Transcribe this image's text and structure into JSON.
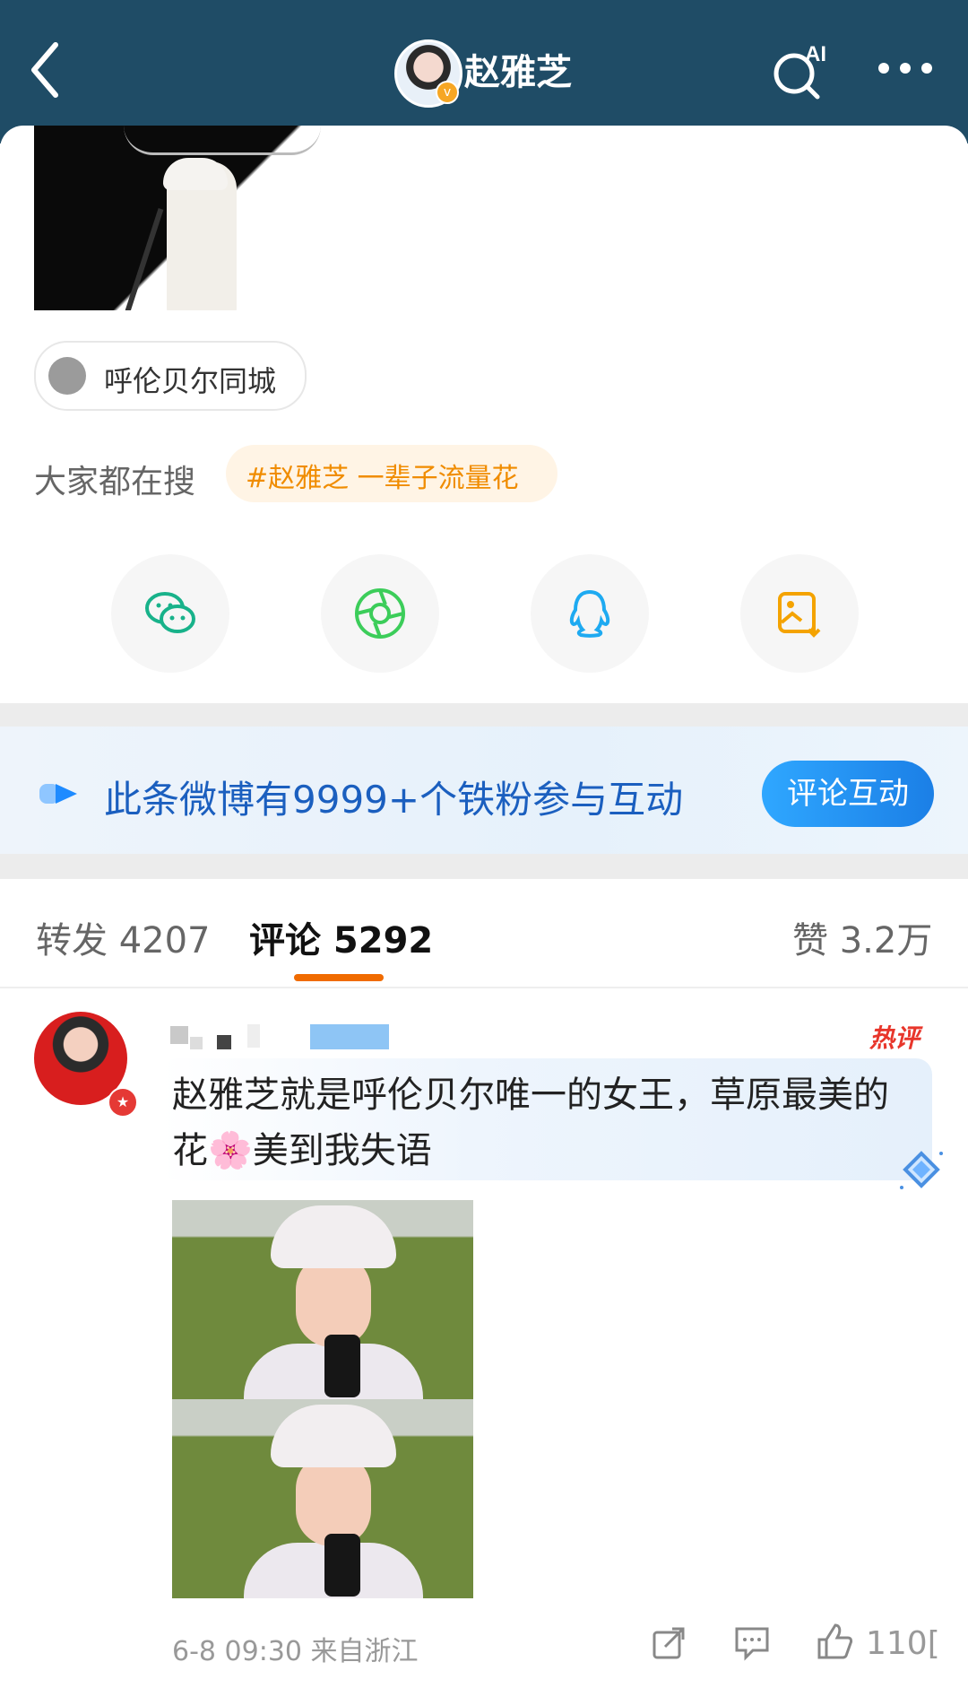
{
  "header": {
    "title": "赵雅芝",
    "ai_search_label": "AI"
  },
  "post": {
    "location": "呼伦贝尔同城",
    "trend_label": "大家都在搜",
    "trend_tag": "#赵雅芝 一辈子流量花"
  },
  "share_icons": [
    "wechat-icon",
    "moments-icon",
    "qq-icon",
    "save-image-icon"
  ],
  "fan_banner": {
    "text": "此条微博有9999+个铁粉参与互动",
    "button": "评论互动"
  },
  "tabs": {
    "repost": "转发 4207",
    "comments": "评论 5292",
    "likes": "赞 3.2万"
  },
  "comment": {
    "hot_tag": "热评",
    "text": "赵雅芝就是呼伦贝尔唯一的女王，草原最美的花🌸美到我失语",
    "time": "6-8 09:30 来自浙江",
    "like_count": "110[",
    "image_count": 2
  },
  "colors": {
    "header_bg": "#1f4c66",
    "accent_orange": "#f06b00",
    "link_blue": "#1b5fbf",
    "hot_red": "#e8362b"
  }
}
